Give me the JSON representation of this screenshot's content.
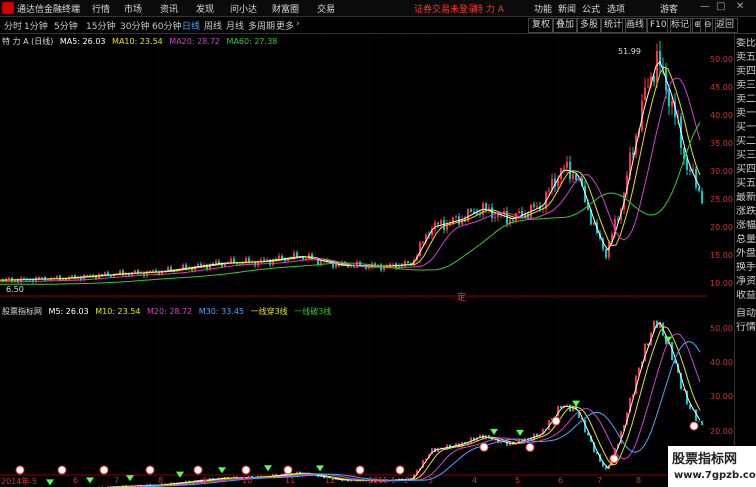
{
  "app": {
    "title": "通达信金融终端"
  },
  "menu": [
    "行情",
    "市场",
    "资讯",
    "发现",
    "问小达",
    "财富圈",
    "交易"
  ],
  "warning": "证券交易未登录",
  "stock_name_top": "特 力 A",
  "right_menu": [
    "功能",
    "新闻",
    "公式",
    "选项"
  ],
  "guest": "游客",
  "win_buttons": [
    "—",
    "□",
    "✕"
  ],
  "periods": [
    "分时",
    "1分钟",
    "5分钟",
    "15分钟",
    "30分钟",
    "60分钟",
    "日线",
    "周线",
    "月线",
    "多周期",
    "更多"
  ],
  "period_more_arrow": "›",
  "tools": [
    "复权",
    "叠加",
    "多股",
    "统计",
    "画线",
    "F10",
    "标记",
    "⊕",
    "⊖",
    "返回"
  ],
  "main_legend": {
    "name": "特 力 A (日线)",
    "ma5": "MA5: 26.03",
    "ma10": "MA10: 23.54",
    "ma20": "MA20: 28.72",
    "ma60": "MA60: 27.38"
  },
  "sub_legend": {
    "name": "股票指标网",
    "m5": "M5: 26.03",
    "m10": "M10: 23.54",
    "m20": "M20: 28.72",
    "m30": "M30: 33.45",
    "line1": "一线穿3线",
    "line2": "一线破3线"
  },
  "annotations": {
    "peak": "51.99",
    "low": "6.50",
    "marker": "定"
  },
  "price_axis": [
    "50.00",
    "45.00",
    "40.00",
    "35.00",
    "30.00",
    "25.00",
    "20.00",
    "15.00",
    "10.00"
  ],
  "sub_axis": [
    "50.00",
    "40.00",
    "30.00",
    "20.00"
  ],
  "x_axis": [
    "2014年 5",
    "6",
    "7",
    "8",
    "9",
    "10",
    "11",
    "12",
    "2015 1",
    "2",
    "3",
    "4",
    "5",
    "6",
    "7",
    "8"
  ],
  "right_panel": [
    "委比",
    "卖五",
    "卖四",
    "卖三",
    "卖二",
    "卖一",
    "买一",
    "买二",
    "买三",
    "买四",
    "买五",
    "最新",
    "涨跌",
    "涨幅",
    "总量",
    "外盘",
    "换手",
    "净资",
    "收益",
    "自动",
    "行情"
  ],
  "watermark": {
    "line1": "股票指标网",
    "line2": "www.7gpzb.com"
  },
  "colors": {
    "ma5": "#ffffff",
    "ma10": "#e6e600",
    "ma20": "#cc44cc",
    "ma60": "#33cc33",
    "up": "#ff3333",
    "down": "#00cccc"
  }
}
